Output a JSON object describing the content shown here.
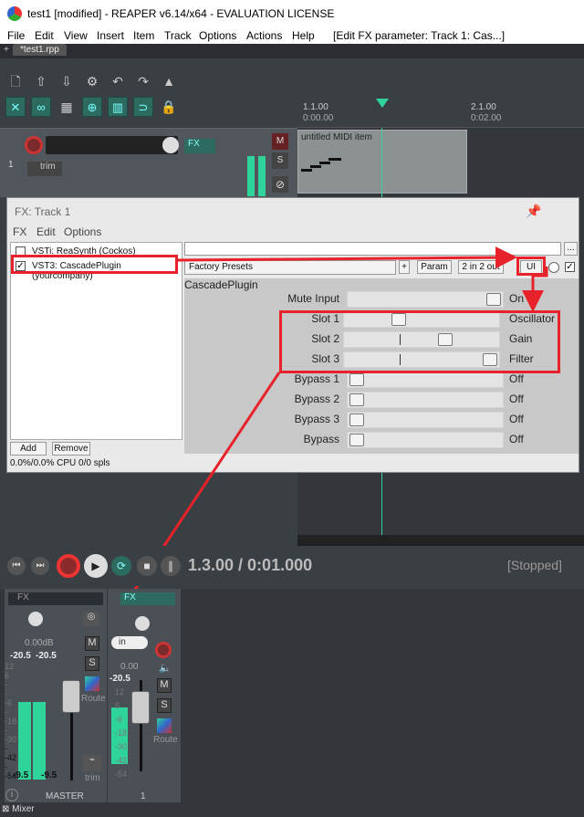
{
  "window": {
    "title": "test1 [modified] - REAPER v6.14/x64 - EVALUATION LICENSE"
  },
  "menu": [
    "File",
    "Edit",
    "View",
    "Insert",
    "Item",
    "Track",
    "Options",
    "Actions",
    "Help"
  ],
  "menu_status": "[Edit FX parameter: Track 1: Cas...]",
  "project_tab": "*test1.rpp",
  "timeline": {
    "marker1_bar": "1.1.00",
    "marker1_time": "0:00.00",
    "marker2_bar": "2.1.00",
    "marker2_time": "0:02.00"
  },
  "track": {
    "number": "1",
    "trim": "trim",
    "fx": "FX",
    "mute": "M",
    "solo": "S",
    "item_name": "untitled MIDI item"
  },
  "fx_window": {
    "title": "FX: Track 1",
    "menu": [
      "FX",
      "Edit",
      "Options"
    ],
    "plugins": [
      {
        "name": "VSTi: ReaSynth (Cockos)",
        "checked": false
      },
      {
        "name": "VST3: CascadePlugin (yourcompany)",
        "checked": true
      }
    ],
    "preset": "Factory Presets",
    "plus": "+",
    "param": "Param",
    "io": "2 in 2 out",
    "ui": "UI",
    "more": "...",
    "plugin_name": "CascadePlugin",
    "params": [
      {
        "label": "Mute Input",
        "value": "On",
        "pos": 1.0
      },
      {
        "label": "Slot 1",
        "value": "Oscillator",
        "pos": 0.33
      },
      {
        "label": "Slot 2",
        "value": "Gain",
        "pos": 0.67
      },
      {
        "label": "Slot 3",
        "value": "Filter",
        "pos": 1.0
      },
      {
        "label": "Bypass 1",
        "value": "Off",
        "pos": 0.0
      },
      {
        "label": "Bypass 2",
        "value": "Off",
        "pos": 0.0
      },
      {
        "label": "Bypass 3",
        "value": "Off",
        "pos": 0.0
      },
      {
        "label": "Bypass",
        "value": "Off",
        "pos": 0.0
      }
    ],
    "add": "Add",
    "remove": "Remove",
    "cpu": "0.0%/0.0% CPU 0/0 spls"
  },
  "transport": {
    "position": "1.3.00 / 0:01.000",
    "status": "[Stopped]"
  },
  "mixer": {
    "master": {
      "fx": "FX",
      "volume": "0.00dB",
      "peak_l": "-20.5",
      "peak_r": "-20.5",
      "scale": [
        "12",
        "6",
        "-",
        "-",
        "-6",
        "-",
        "-18",
        "-",
        "-30",
        "-",
        "-42",
        "-",
        "-54"
      ],
      "meter_bottom_l": "-9.5",
      "meter_bottom_r": "-9.5",
      "mute": "M",
      "solo": "S",
      "route": "Route",
      "trim": "trim",
      "name": "MASTER"
    },
    "track1": {
      "fx": "FX",
      "in": "in",
      "volume": "0.00",
      "peak": "-20.5",
      "scale": [
        "12",
        "6",
        "-6",
        "-18",
        "-30",
        "-42",
        "-54"
      ],
      "mute": "M",
      "solo": "S",
      "route": "Route",
      "number": "1"
    },
    "tab": "Mixer"
  }
}
